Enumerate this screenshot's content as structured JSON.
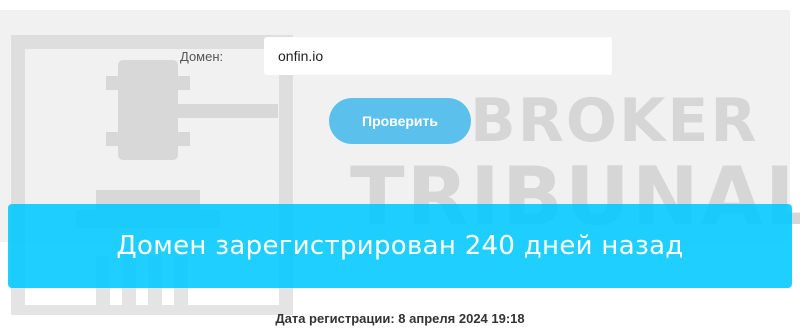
{
  "form": {
    "domain_label": "Домен:",
    "domain_value": "onfin.io",
    "check_button_label": "Проверить"
  },
  "result": {
    "banner_text": "Домен зарегистрирован 240 дней назад",
    "registration_date": "Дата регистрации: 8 апреля 2024 19:18"
  },
  "watermark": {
    "line1": "BROKER",
    "line2": "TRIBUNAL",
    "icon": "gavel-icon"
  },
  "colors": {
    "panel_background": "#f1f1f1",
    "button": "#5bc1ec",
    "banner": "#00c8ff",
    "watermark": "#d6d6d6"
  }
}
